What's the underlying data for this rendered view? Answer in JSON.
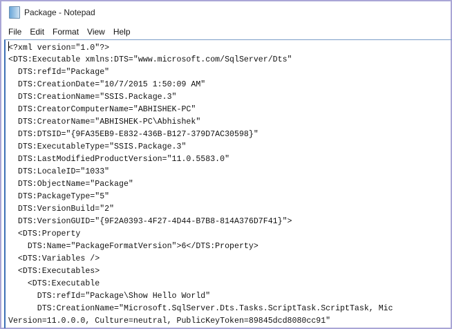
{
  "window": {
    "title": "Package - Notepad",
    "icon": "notepad-icon"
  },
  "menu": [
    "File",
    "Edit",
    "Format",
    "View",
    "Help"
  ],
  "editor": {
    "lines": [
      "<?xml version=\"1.0\"?>",
      "<DTS:Executable xmlns:DTS=\"www.microsoft.com/SqlServer/Dts\"",
      "  DTS:refId=\"Package\"",
      "  DTS:CreationDate=\"10/7/2015 1:50:09 AM\"",
      "  DTS:CreationName=\"SSIS.Package.3\"",
      "  DTS:CreatorComputerName=\"ABHISHEK-PC\"",
      "  DTS:CreatorName=\"ABHISHEK-PC\\Abhishek\"",
      "  DTS:DTSID=\"{9FA35EB9-E832-436B-B127-379D7AC30598}\"",
      "  DTS:ExecutableType=\"SSIS.Package.3\"",
      "  DTS:LastModifiedProductVersion=\"11.0.5583.0\"",
      "  DTS:LocaleID=\"1033\"",
      "  DTS:ObjectName=\"Package\"",
      "  DTS:PackageType=\"5\"",
      "  DTS:VersionBuild=\"2\"",
      "  DTS:VersionGUID=\"{9F2A0393-4F27-4D44-B7B8-814A376D7F41}\">",
      "  <DTS:Property",
      "    DTS:Name=\"PackageFormatVersion\">6</DTS:Property>",
      "  <DTS:Variables />",
      "  <DTS:Executables>",
      "    <DTS:Executable",
      "      DTS:refId=\"Package\\Show Hello World\"",
      "      DTS:CreationName=\"Microsoft.SqlServer.Dts.Tasks.ScriptTask.ScriptTask, Mic",
      "Version=11.0.0.0, Culture=neutral, PublicKeyToken=89845dcd8080cc91\""
    ]
  }
}
